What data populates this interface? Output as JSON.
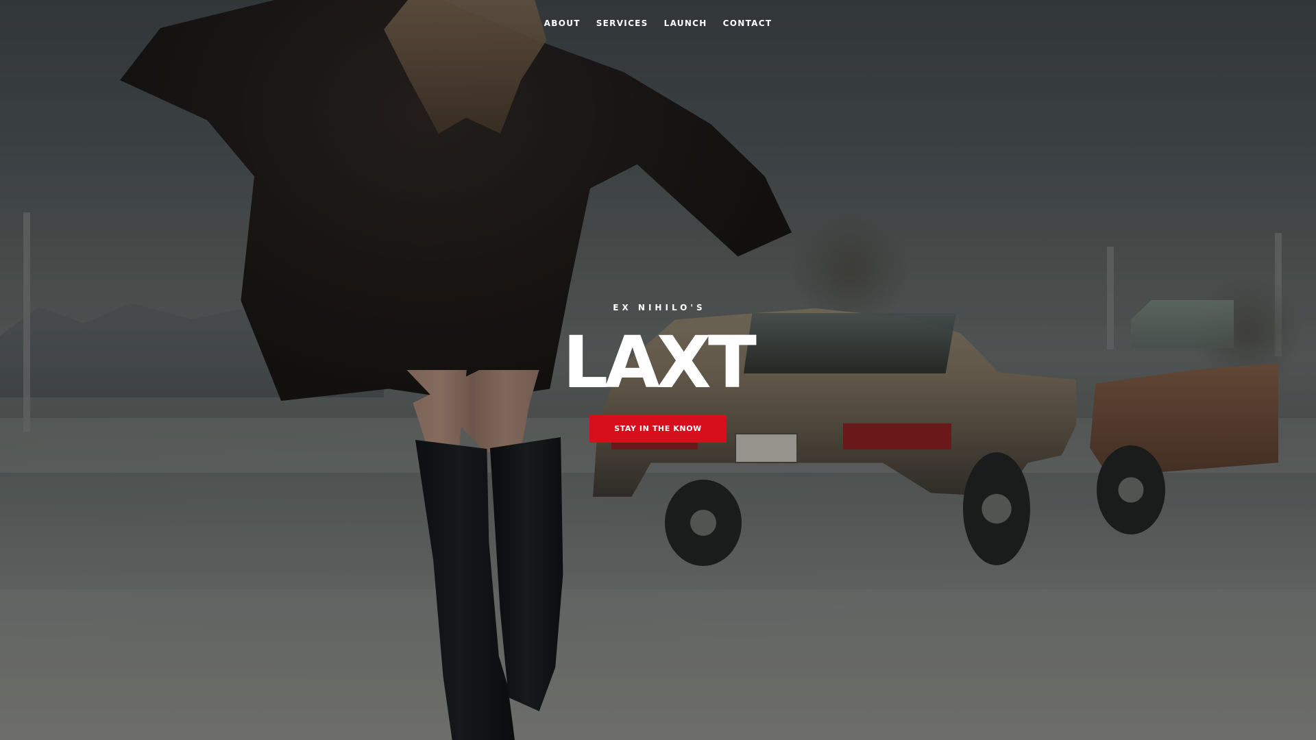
{
  "nav": {
    "items": [
      {
        "label": "ABOUT"
      },
      {
        "label": "SERVICES"
      },
      {
        "label": "LAUNCH"
      },
      {
        "label": "CONTACT"
      }
    ]
  },
  "hero": {
    "eyebrow": "EX NIHILO'S",
    "title": "LAXT",
    "cta_label": "STAY IN THE KNOW"
  },
  "colors": {
    "accent": "#d70f1c",
    "text": "#ffffff"
  }
}
